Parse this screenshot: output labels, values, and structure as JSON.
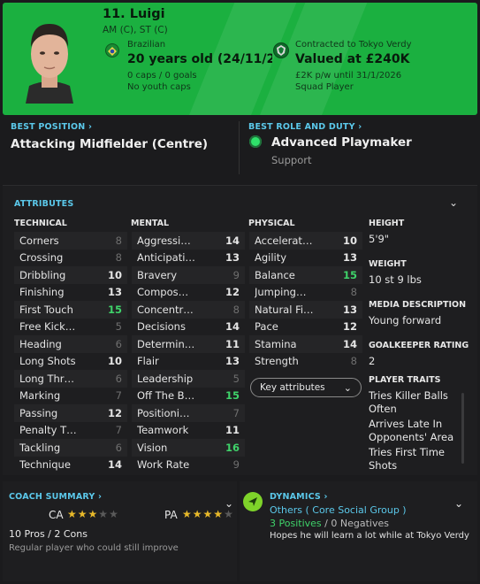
{
  "player": {
    "name": "11. Luigi",
    "positions": "AM (C), ST (C)",
    "nationality": "Brazilian",
    "age_dob": "20 years old (24/11/200…",
    "caps": "0 caps / 0 goals",
    "youth_caps": "No youth caps",
    "contract": "Contracted to Tokyo Verdy",
    "value": "Valued at £240K",
    "wage": "£2K p/w until 31/1/2026",
    "squad_status": "Squad Player"
  },
  "best_position": {
    "title": "BEST POSITION",
    "value": "Attacking Midfielder (Centre)"
  },
  "best_role": {
    "title": "BEST ROLE AND DUTY",
    "role": "Advanced Playmaker",
    "duty": "Support"
  },
  "attributes": {
    "title": "ATTRIBUTES",
    "technical_head": "TECHNICAL",
    "mental_head": "MENTAL",
    "physical_head": "PHYSICAL",
    "technical": [
      {
        "name": "Corners",
        "value": "8"
      },
      {
        "name": "Crossing",
        "value": "8"
      },
      {
        "name": "Dribbling",
        "value": "10"
      },
      {
        "name": "Finishing",
        "value": "13"
      },
      {
        "name": "First Touch",
        "value": "15"
      },
      {
        "name": "Free Kick…",
        "value": "5"
      },
      {
        "name": "Heading",
        "value": "6"
      },
      {
        "name": "Long Shots",
        "value": "10"
      },
      {
        "name": "Long Thr…",
        "value": "6"
      },
      {
        "name": "Marking",
        "value": "7"
      },
      {
        "name": "Passing",
        "value": "12"
      },
      {
        "name": "Penalty T…",
        "value": "7"
      },
      {
        "name": "Tackling",
        "value": "6"
      },
      {
        "name": "Technique",
        "value": "14"
      }
    ],
    "mental": [
      {
        "name": "Aggressi…",
        "value": "14"
      },
      {
        "name": "Anticipati…",
        "value": "13"
      },
      {
        "name": "Bravery",
        "value": "9"
      },
      {
        "name": "Compos…",
        "value": "12"
      },
      {
        "name": "Concentr…",
        "value": "8"
      },
      {
        "name": "Decisions",
        "value": "14"
      },
      {
        "name": "Determin…",
        "value": "11"
      },
      {
        "name": "Flair",
        "value": "13"
      },
      {
        "name": "Leadership",
        "value": "5"
      },
      {
        "name": "Off The B…",
        "value": "15"
      },
      {
        "name": "Positioni…",
        "value": "7"
      },
      {
        "name": "Teamwork",
        "value": "11"
      },
      {
        "name": "Vision",
        "value": "16"
      },
      {
        "name": "Work Rate",
        "value": "9"
      }
    ],
    "physical": [
      {
        "name": "Accelerat…",
        "value": "10"
      },
      {
        "name": "Agility",
        "value": "13"
      },
      {
        "name": "Balance",
        "value": "15"
      },
      {
        "name": "Jumping…",
        "value": "8"
      },
      {
        "name": "Natural Fi…",
        "value": "13"
      },
      {
        "name": "Pace",
        "value": "12"
      },
      {
        "name": "Stamina",
        "value": "14"
      },
      {
        "name": "Strength",
        "value": "8"
      }
    ],
    "key_attributes_label": "Key attributes"
  },
  "side": {
    "height_label": "HEIGHT",
    "height": "5'9\"",
    "weight_label": "WEIGHT",
    "weight": "10 st 9 lbs",
    "media_label": "MEDIA DESCRIPTION",
    "media": "Young forward",
    "gk_label": "GOALKEEPER RATING",
    "gk": "2",
    "traits_label": "PLAYER TRAITS",
    "traits": [
      "Tries Killer Balls Often",
      "Arrives Late In Opponents' Area",
      "Tries First Time Shots"
    ]
  },
  "coach": {
    "title": "COACH SUMMARY",
    "ca_label": "CA",
    "pa_label": "PA",
    "ca_stars": 3,
    "pa_stars": 3.5,
    "pros_cons": "10 Pros / 2 Cons",
    "summary": "Regular player who could still improve"
  },
  "dynamics": {
    "title": "DYNAMICS",
    "group": "Others",
    "group_detail": "( Core Social Group )",
    "positives": "3 Positives",
    "separator": "/",
    "negatives": "0 Negatives",
    "note": "Hopes he will learn a lot while at Tokyo Verdy"
  },
  "colors": {
    "accent_green": "#1bb040",
    "link_blue": "#5bc8ea",
    "high_value": "#3fd36a",
    "star_gold": "#e8b92a"
  }
}
